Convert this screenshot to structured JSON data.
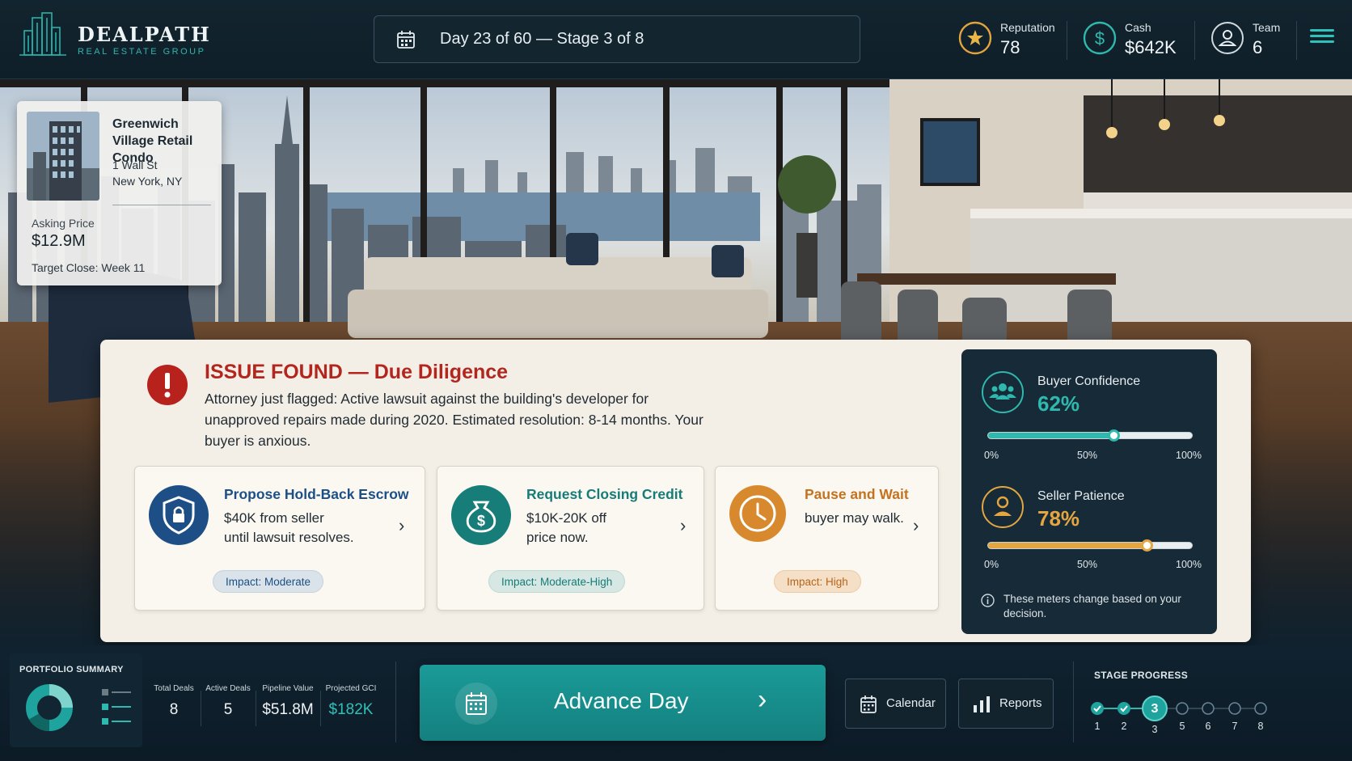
{
  "header": {
    "brand_name": "DEALPATH",
    "brand_sub": "REAL ESTATE GROUP",
    "day_status": "Day 23 of 60 — Stage 3 of 8",
    "stats": [
      {
        "label": "Reputation",
        "value": "78",
        "icon": "star-icon"
      },
      {
        "label": "Cash",
        "value": "$642K",
        "icon": "dollar-icon"
      },
      {
        "label": "Team",
        "value": "6",
        "icon": "person-icon"
      }
    ]
  },
  "property": {
    "name": "Greenwich Village Retail Condo",
    "address_line1": "1 Wall St",
    "address_line2": "New York, NY",
    "asking_label": "Asking Price",
    "asking_price": "$12.9M",
    "target_close": "Target Close: Week 11"
  },
  "issue": {
    "title": "ISSUE FOUND — Due Diligence",
    "body": "Attorney just flagged: Active lawsuit against the building's developer for unapproved repairs made during 2020. Estimated resolution: 8-14 months. Your buyer is anxious.",
    "choices": [
      {
        "title": "Propose Hold-Back Escrow",
        "desc_line1": "$40K from seller",
        "desc_line2": "until lawsuit resolves.",
        "impact": "Impact: Moderate",
        "color": "#1c4f86"
      },
      {
        "title": "Request Closing Credit",
        "desc_line1": "$10K-20K off",
        "desc_line2": "price now.",
        "impact": "Impact: Moderate-High",
        "color": "#167c77"
      },
      {
        "title": "Pause and Wait",
        "desc_line1": "buyer may walk.",
        "desc_line2": "",
        "impact": "Impact: High",
        "color": "#c4721e"
      }
    ]
  },
  "meters": {
    "buyer": {
      "label": "Buyer Confidence",
      "value": "62%",
      "level": 0.62,
      "color": "#2fb8ae"
    },
    "seller": {
      "label": "Seller Patience",
      "value": "78%",
      "level": 0.78,
      "color": "#e3a640"
    },
    "ticks": [
      "0%",
      "50%",
      "100%"
    ],
    "note": "These meters change based on your decision."
  },
  "footer": {
    "portfolio_title": "PORTFOLIO SUMMARY",
    "kpis": [
      {
        "label": "Total Deals",
        "value": "8"
      },
      {
        "label": "Active Deals",
        "value": "5"
      },
      {
        "label": "Pipeline Value",
        "value": "$51.8M"
      },
      {
        "label": "Projected GCI",
        "value": "$182K"
      }
    ],
    "advance_label": "Advance Day",
    "calendar_label": "Calendar",
    "reports_label": "Reports",
    "stage_title": "STAGE PROGRESS",
    "stages": [
      "1",
      "2",
      "3",
      "5",
      "6",
      "7",
      "8"
    ],
    "current_stage": "3"
  }
}
